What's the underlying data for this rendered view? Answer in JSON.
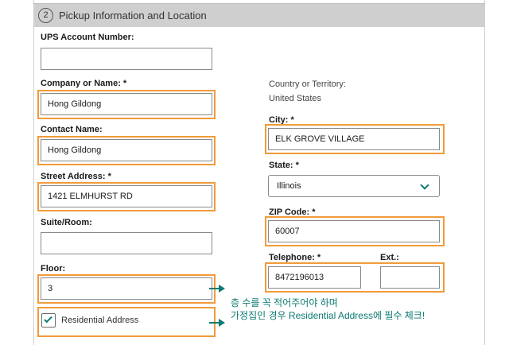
{
  "section": {
    "step_number": "2",
    "title": "Pickup Information and Location"
  },
  "form": {
    "ups_account": {
      "label": "UPS Account Number:",
      "value": ""
    },
    "company": {
      "label": "Company or Name: *",
      "value": "Hong Gildong"
    },
    "contact": {
      "label": "Contact Name:",
      "value": "Hong Gildong"
    },
    "street": {
      "label": "Street Address: *",
      "value": "1421 ELMHURST RD"
    },
    "suite": {
      "label": "Suite/Room:",
      "value": ""
    },
    "floor": {
      "label": "Floor:",
      "value": "3"
    },
    "residential": {
      "label": "Residential Address",
      "checked": true
    },
    "country": {
      "label": "Country or Territory:",
      "value": "United States"
    },
    "city": {
      "label": "City: *",
      "value": "ELK GROVE VILLAGE"
    },
    "state": {
      "label": "State: *",
      "value": "Illinois"
    },
    "zip": {
      "label": "ZIP Code: *",
      "value": "60007"
    },
    "telephone": {
      "label": "Telephone: *",
      "value": "8472196013"
    },
    "ext": {
      "label": "Ext.:",
      "value": ""
    }
  },
  "annotations": {
    "line1": "층 수를 꼭 적어주어야 하며",
    "line2": "가정집인 경우 Residential Address에 필수 체크!"
  },
  "colors": {
    "highlight": "#f29a3a",
    "accent": "#0a7a72",
    "header_bg": "#cfcfcf"
  }
}
